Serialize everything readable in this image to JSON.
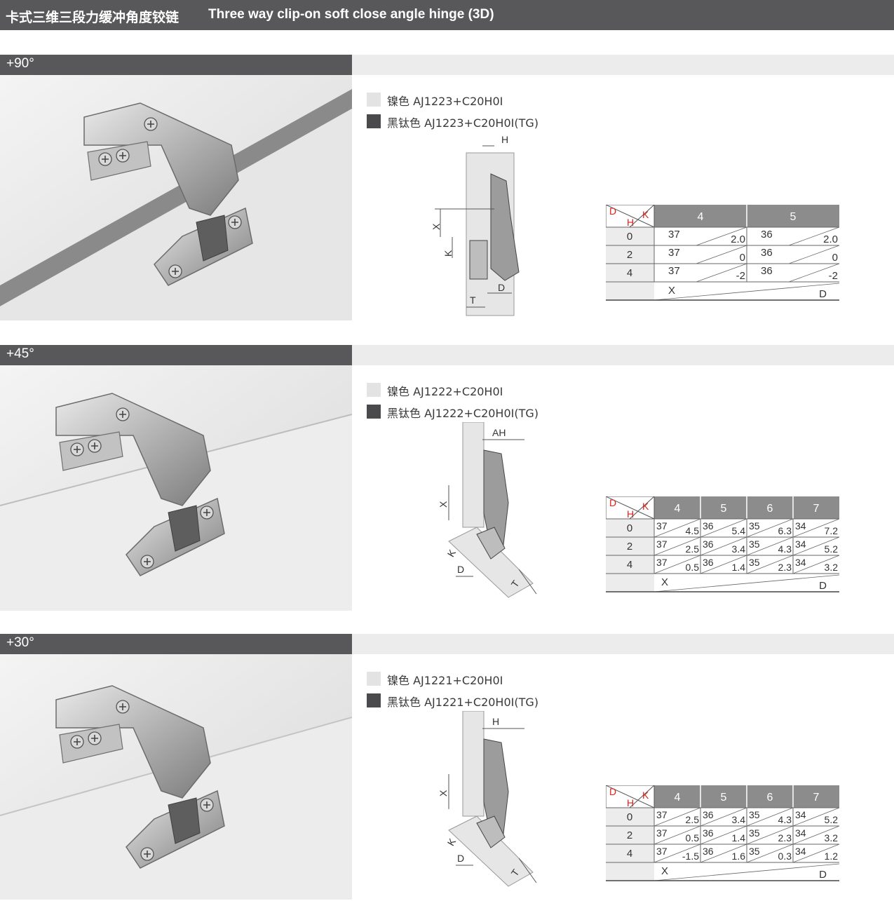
{
  "header": {
    "title_cn": "卡式三维三段力缓冲角度铰链",
    "title_en": "Three way clip-on soft close angle hinge (3D)"
  },
  "colors": {
    "bar": "#58585a",
    "band": "#ececec",
    "accent_red": "#e0221c",
    "nickel": "#e3e3e3",
    "black_titanium": "#4a4a4c"
  },
  "sections": [
    {
      "angle": "+90°",
      "finishes": [
        {
          "name": "镍色",
          "code": "AJ1223+C20H0I",
          "swatch": "nickel"
        },
        {
          "name": "黑钛色",
          "code": "AJ1223+C20H0I(TG)",
          "swatch": "black"
        }
      ],
      "diagram_labels": {
        "h": "H",
        "x": "X",
        "k": "K",
        "d": "D",
        "t": "T"
      },
      "table": {
        "corner": {
          "d": "D",
          "h": "H",
          "k": "K"
        },
        "k_values": [
          "4",
          "5"
        ],
        "rows": [
          {
            "h": "0",
            "cells": [
              [
                "37",
                "2.0"
              ],
              [
                "36",
                "2.0"
              ]
            ]
          },
          {
            "h": "2",
            "cells": [
              [
                "37",
                "0"
              ],
              [
                "36",
                "0"
              ]
            ]
          },
          {
            "h": "4",
            "cells": [
              [
                "37",
                "-2"
              ],
              [
                "36",
                "-2"
              ]
            ]
          }
        ],
        "footer": {
          "x": "X",
          "d": "D"
        }
      }
    },
    {
      "angle": "+45°",
      "finishes": [
        {
          "name": "镍色",
          "code": "AJ1222+C20H0I",
          "swatch": "nickel"
        },
        {
          "name": "黑钛色",
          "code": "AJ1222+C20H0I(TG)",
          "swatch": "black"
        }
      ],
      "diagram_labels": {
        "h": "AH",
        "x": "X",
        "k": "K",
        "d": "D",
        "t": "T"
      },
      "table": {
        "corner": {
          "d": "D",
          "h": "H",
          "k": "K"
        },
        "k_values": [
          "4",
          "5",
          "6",
          "7"
        ],
        "rows": [
          {
            "h": "0",
            "cells": [
              [
                "37",
                "4.5"
              ],
              [
                "36",
                "5.4"
              ],
              [
                "35",
                "6.3"
              ],
              [
                "34",
                "7.2"
              ]
            ]
          },
          {
            "h": "2",
            "cells": [
              [
                "37",
                "2.5"
              ],
              [
                "36",
                "3.4"
              ],
              [
                "35",
                "4.3"
              ],
              [
                "34",
                "5.2"
              ]
            ]
          },
          {
            "h": "4",
            "cells": [
              [
                "37",
                "0.5"
              ],
              [
                "36",
                "1.4"
              ],
              [
                "35",
                "2.3"
              ],
              [
                "34",
                "3.2"
              ]
            ]
          }
        ],
        "footer": {
          "x": "X",
          "d": "D"
        }
      }
    },
    {
      "angle": "+30°",
      "finishes": [
        {
          "name": "镍色",
          "code": "AJ1221+C20H0I",
          "swatch": "nickel"
        },
        {
          "name": "黑钛色",
          "code": "AJ1221+C20H0I(TG)",
          "swatch": "black"
        }
      ],
      "diagram_labels": {
        "h": "H",
        "x": "X",
        "k": "K",
        "d": "D",
        "t": "T"
      },
      "table": {
        "corner": {
          "d": "D",
          "h": "H",
          "k": "K"
        },
        "k_values": [
          "4",
          "5",
          "6",
          "7"
        ],
        "rows": [
          {
            "h": "0",
            "cells": [
              [
                "37",
                "2.5"
              ],
              [
                "36",
                "3.4"
              ],
              [
                "35",
                "4.3"
              ],
              [
                "34",
                "5.2"
              ]
            ]
          },
          {
            "h": "2",
            "cells": [
              [
                "37",
                "0.5"
              ],
              [
                "36",
                "1.4"
              ],
              [
                "35",
                "2.3"
              ],
              [
                "34",
                "3.2"
              ]
            ]
          },
          {
            "h": "4",
            "cells": [
              [
                "37",
                "-1.5"
              ],
              [
                "36",
                "1.6"
              ],
              [
                "35",
                "0.3"
              ],
              [
                "34",
                "1.2"
              ]
            ]
          }
        ],
        "footer": {
          "x": "X",
          "d": "D"
        }
      }
    }
  ]
}
